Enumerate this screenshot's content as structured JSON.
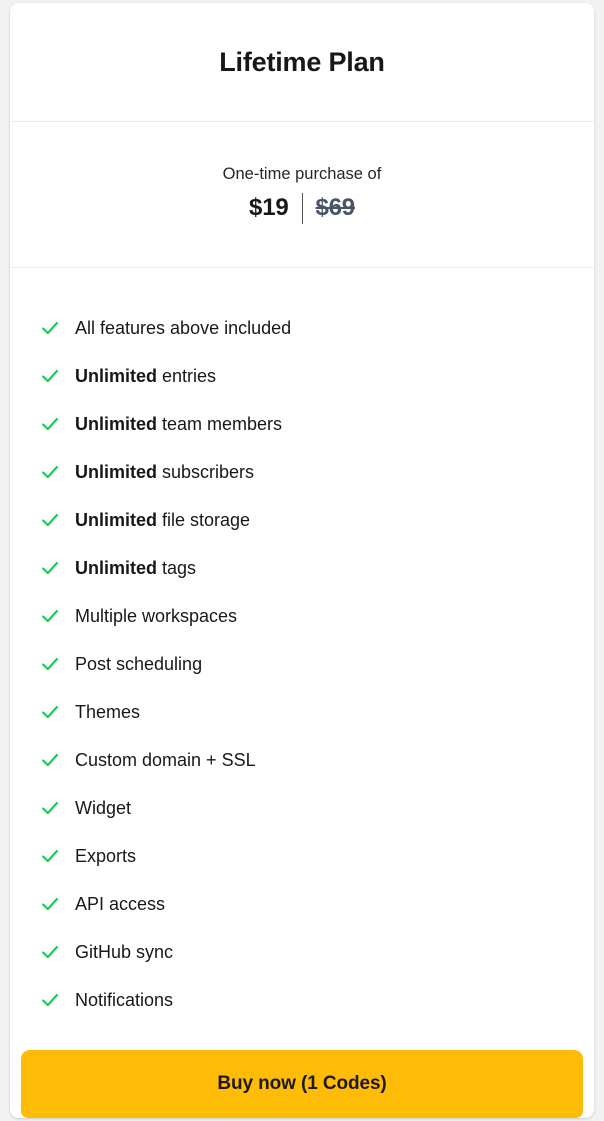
{
  "card": {
    "title": "Lifetime Plan",
    "pricing": {
      "caption": "One-time purchase of",
      "current_price": "$19",
      "original_price": "$69"
    },
    "features": [
      {
        "emphasis": "",
        "text": "All features above included"
      },
      {
        "emphasis": "Unlimited",
        "text": " entries"
      },
      {
        "emphasis": "Unlimited",
        "text": " team members"
      },
      {
        "emphasis": "Unlimited",
        "text": " subscribers"
      },
      {
        "emphasis": "Unlimited",
        "text": " file storage"
      },
      {
        "emphasis": "Unlimited",
        "text": " tags"
      },
      {
        "emphasis": "",
        "text": "Multiple workspaces"
      },
      {
        "emphasis": "",
        "text": "Post scheduling"
      },
      {
        "emphasis": "",
        "text": "Themes"
      },
      {
        "emphasis": "",
        "text": "Custom domain + SSL"
      },
      {
        "emphasis": "",
        "text": "Widget"
      },
      {
        "emphasis": "",
        "text": "Exports"
      },
      {
        "emphasis": "",
        "text": "API access"
      },
      {
        "emphasis": "",
        "text": "GitHub sync"
      },
      {
        "emphasis": "",
        "text": "Notifications"
      }
    ],
    "feature_icon": "check-icon",
    "cta": {
      "label": "Buy now (1 Codes)"
    }
  },
  "colors": {
    "page_background": "#f1f2f3",
    "card_background": "#ffffff",
    "check_green": "#22c55e",
    "cta_background": "#ffbc06",
    "cta_text": "#1c1917",
    "title_text": "#18181b",
    "old_price_text": "#475569",
    "divider": "#ededf0"
  }
}
